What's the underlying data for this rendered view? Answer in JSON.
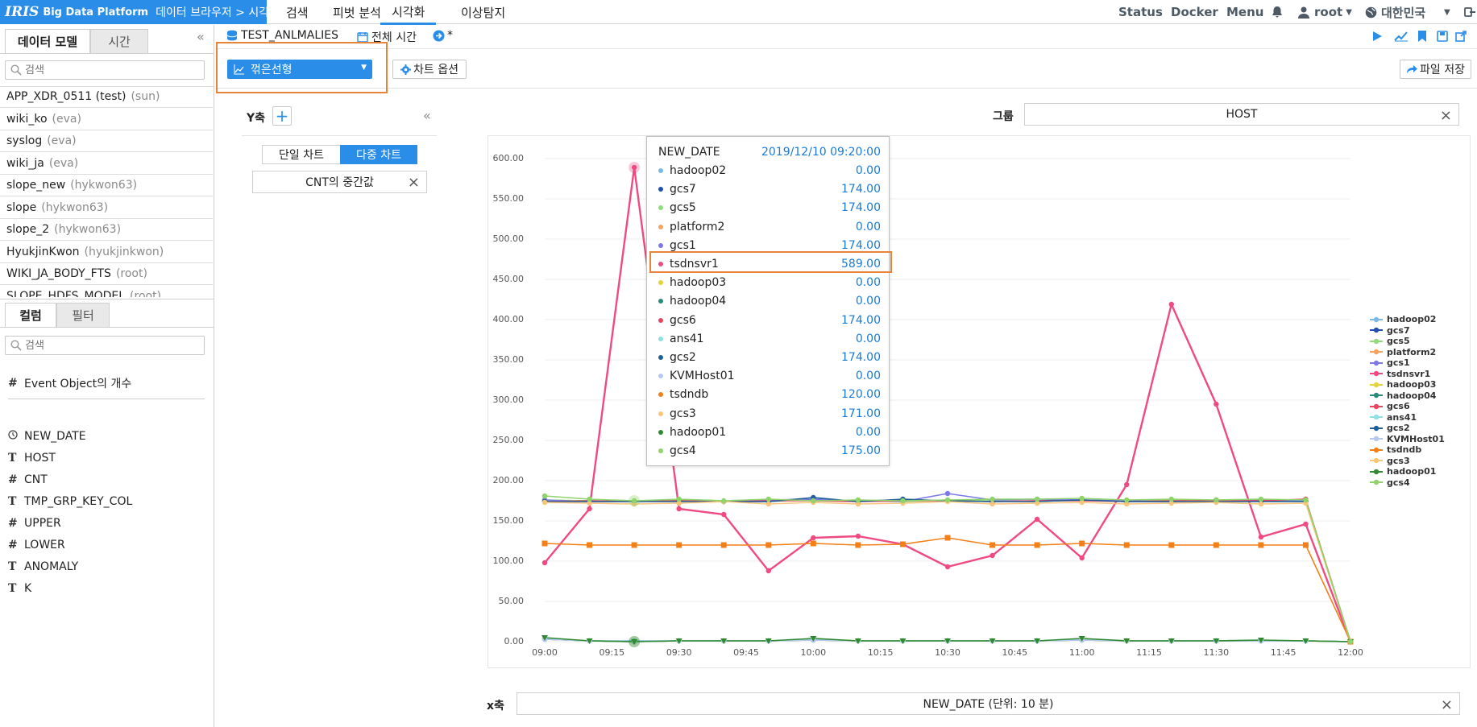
{
  "app": {
    "brand_logo": "IRIS",
    "brand_product": "Big Data Platform",
    "breadcrumb": "데이터 브라우저 > 시각화"
  },
  "topnav": [
    {
      "label": "검색"
    },
    {
      "label": "피벗 분석"
    },
    {
      "label": "시각화"
    },
    {
      "label": "이상탐지"
    }
  ],
  "topright": {
    "status": "Status",
    "docker": "Docker",
    "menu": "Menu",
    "user": "root",
    "region": "대한민국"
  },
  "leftpanel": {
    "tabs": [
      "데이터 모델",
      "시간"
    ],
    "search_placeholder": "검색",
    "models": [
      {
        "name": "APP_XDR_0511 (test)",
        "owner": "(sun)"
      },
      {
        "name": "wiki_ko",
        "owner": "(eva)"
      },
      {
        "name": "syslog",
        "owner": "(eva)"
      },
      {
        "name": "wiki_ja",
        "owner": "(eva)"
      },
      {
        "name": "slope_new",
        "owner": "(hykwon63)"
      },
      {
        "name": "slope",
        "owner": "(hykwon63)"
      },
      {
        "name": "slope_2",
        "owner": "(hykwon63)"
      },
      {
        "name": "HyukjinKwon",
        "owner": "(hyukjinkwon)"
      },
      {
        "name": "WIKI_JA_BODY_FTS",
        "owner": "(root)"
      },
      {
        "name": "SLOPE_HDFS_MODEL",
        "owner": "(root)"
      }
    ],
    "col_tabs": [
      "컬럼",
      "필터"
    ],
    "col_search_placeholder": "검색",
    "event_count": {
      "type": "#",
      "label": "Event Object의 개수"
    },
    "columns": [
      {
        "type": "clock",
        "name": "NEW_DATE"
      },
      {
        "type": "T",
        "name": "HOST"
      },
      {
        "type": "#",
        "name": "CNT"
      },
      {
        "type": "T",
        "name": "TMP_GRP_KEY_COL"
      },
      {
        "type": "#",
        "name": "UPPER"
      },
      {
        "type": "#",
        "name": "LOWER"
      },
      {
        "type": "T",
        "name": "ANOMALY"
      },
      {
        "type": "T",
        "name": "K"
      }
    ]
  },
  "toolbar": {
    "model_name": "TEST_ANLMALIES",
    "time_range": "전체 시간",
    "unsaved": "*"
  },
  "controls": {
    "chart_type": "꺾은선형",
    "chart_options": "차트 옵션",
    "save_file": "파일 저장"
  },
  "yaxis": {
    "label": "Y축",
    "single_chart": "단일 차트",
    "multi_chart": "다중 차트",
    "measure": "CNT의 중간값"
  },
  "group": {
    "label": "그룹",
    "value": "HOST"
  },
  "xaxis": {
    "label": "x축",
    "value": "NEW_DATE (단위: 10 분)"
  },
  "tooltip": {
    "header_label": "NEW_DATE",
    "header_value": "2019/12/10 09:20:00",
    "rows": [
      {
        "name": "hadoop02",
        "value": "0.00",
        "color": "#7ab8e6"
      },
      {
        "name": "gcs7",
        "value": "174.00",
        "color": "#1f4fb0"
      },
      {
        "name": "gcs5",
        "value": "174.00",
        "color": "#8fdc7a"
      },
      {
        "name": "platform2",
        "value": "0.00",
        "color": "#f4a460"
      },
      {
        "name": "gcs1",
        "value": "174.00",
        "color": "#7b79e8"
      },
      {
        "name": "tsdnsvr1",
        "value": "589.00",
        "color": "#ef4a82"
      },
      {
        "name": "hadoop03",
        "value": "0.00",
        "color": "#e6d23a"
      },
      {
        "name": "hadoop04",
        "value": "0.00",
        "color": "#2b8a7a"
      },
      {
        "name": "gcs6",
        "value": "174.00",
        "color": "#e8455e"
      },
      {
        "name": "ans41",
        "value": "0.00",
        "color": "#8fe0e6"
      },
      {
        "name": "gcs2",
        "value": "174.00",
        "color": "#1f5f99"
      },
      {
        "name": "KVMHost01",
        "value": "0.00",
        "color": "#b6c8ef"
      },
      {
        "name": "tsdndb",
        "value": "120.00",
        "color": "#f57f17"
      },
      {
        "name": "gcs3",
        "value": "171.00",
        "color": "#f7c67a"
      },
      {
        "name": "hadoop01",
        "value": "0.00",
        "color": "#2f8a2f"
      },
      {
        "name": "gcs4",
        "value": "175.00",
        "color": "#8fd46a"
      }
    ]
  },
  "chart_data": {
    "type": "line",
    "x": [
      "09:00",
      "09:10",
      "09:20",
      "09:30",
      "09:40",
      "09:50",
      "10:00",
      "10:10",
      "10:20",
      "10:30",
      "10:40",
      "10:50",
      "11:00",
      "11:10",
      "11:20",
      "11:30",
      "11:40",
      "11:50",
      "12:00"
    ],
    "x_ticks": [
      "09:00",
      "09:15",
      "09:30",
      "09:45",
      "10:00",
      "10:15",
      "10:30",
      "10:45",
      "11:00",
      "11:15",
      "11:30",
      "11:45",
      "12:00"
    ],
    "y_ticks": [
      "0.00",
      "50.00",
      "100.00",
      "150.00",
      "200.00",
      "250.00",
      "300.00",
      "350.00",
      "400.00",
      "450.00",
      "500.00",
      "550.00",
      "600.00"
    ],
    "ylim": [
      0,
      600
    ],
    "legend_position": "right",
    "series": [
      {
        "name": "hadoop02",
        "color": "#7ab8e6",
        "values": [
          4,
          1,
          1,
          1,
          1,
          1,
          3,
          1,
          1,
          1,
          1,
          1,
          3,
          1,
          1,
          1,
          1,
          1,
          0
        ]
      },
      {
        "name": "gcs7",
        "color": "#1f4fb0",
        "values": [
          175,
          175,
          174,
          175,
          174,
          174,
          177,
          175,
          176,
          175,
          174,
          175,
          176,
          174,
          174,
          176,
          175,
          175,
          0
        ]
      },
      {
        "name": "gcs5",
        "color": "#8fdc7a",
        "values": [
          176,
          175,
          174,
          176,
          174,
          176,
          175,
          176,
          174,
          176,
          175,
          174,
          176,
          175,
          176,
          174,
          176,
          175,
          0
        ]
      },
      {
        "name": "platform2",
        "color": "#f4a460",
        "values": [
          3,
          1,
          0,
          1,
          1,
          1,
          2,
          1,
          1,
          1,
          1,
          1,
          2,
          1,
          1,
          1,
          1,
          1,
          0
        ]
      },
      {
        "name": "gcs1",
        "color": "#7b79e8",
        "values": [
          176,
          174,
          174,
          175,
          174,
          176,
          177,
          175,
          174,
          184,
          176,
          177,
          176,
          175,
          174,
          175,
          176,
          175,
          0
        ]
      },
      {
        "name": "tsdnsvr1",
        "color": "#ef4a82",
        "values": [
          98,
          165,
          589,
          165,
          158,
          88,
          129,
          131,
          121,
          93,
          107,
          152,
          104,
          195,
          419,
          295,
          130,
          146,
          0
        ]
      },
      {
        "name": "hadoop03",
        "color": "#e6d23a",
        "values": [
          3,
          1,
          0,
          1,
          1,
          1,
          2,
          1,
          1,
          1,
          1,
          1,
          2,
          1,
          1,
          1,
          1,
          1,
          0
        ]
      },
      {
        "name": "hadoop04",
        "color": "#2b8a7a",
        "values": [
          3,
          1,
          0,
          1,
          1,
          1,
          2,
          1,
          1,
          1,
          1,
          1,
          2,
          1,
          1,
          1,
          1,
          1,
          0
        ]
      },
      {
        "name": "gcs6",
        "color": "#e8455e",
        "values": [
          174,
          175,
          174,
          175,
          174,
          175,
          175,
          174,
          175,
          175,
          174,
          175,
          175,
          174,
          175,
          175,
          175,
          177,
          0
        ]
      },
      {
        "name": "ans41",
        "color": "#8fe0e6",
        "values": [
          3,
          1,
          0,
          1,
          1,
          1,
          2,
          1,
          1,
          1,
          1,
          1,
          2,
          1,
          1,
          1,
          1,
          1,
          0
        ]
      },
      {
        "name": "gcs2",
        "color": "#1f5f99",
        "values": [
          174,
          174,
          174,
          174,
          174,
          174,
          179,
          174,
          177,
          175,
          174,
          174,
          176,
          174,
          174,
          174,
          174,
          174,
          0
        ]
      },
      {
        "name": "KVMHost01",
        "color": "#b6c8ef",
        "values": [
          3,
          1,
          0,
          1,
          1,
          1,
          2,
          1,
          1,
          1,
          1,
          1,
          2,
          1,
          1,
          1,
          1,
          1,
          0
        ]
      },
      {
        "name": "tsdndb",
        "color": "#f57f17",
        "values": [
          122,
          120,
          120,
          120,
          120,
          120,
          122,
          120,
          121,
          129,
          120,
          120,
          122,
          120,
          120,
          120,
          120,
          120,
          0
        ]
      },
      {
        "name": "gcs3",
        "color": "#f7c67a",
        "values": [
          173,
          172,
          171,
          172,
          174,
          171,
          173,
          171,
          172,
          174,
          171,
          172,
          173,
          171,
          172,
          173,
          171,
          172,
          0
        ]
      },
      {
        "name": "hadoop01",
        "color": "#2f8a2f",
        "values": [
          5,
          1,
          0,
          1,
          1,
          1,
          4,
          1,
          1,
          1,
          1,
          1,
          4,
          1,
          1,
          1,
          2,
          1,
          0
        ]
      },
      {
        "name": "gcs4",
        "color": "#8fd46a",
        "values": [
          181,
          177,
          175,
          177,
          175,
          177,
          175,
          176,
          175,
          176,
          177,
          177,
          178,
          176,
          177,
          176,
          177,
          176,
          0
        ]
      }
    ]
  }
}
